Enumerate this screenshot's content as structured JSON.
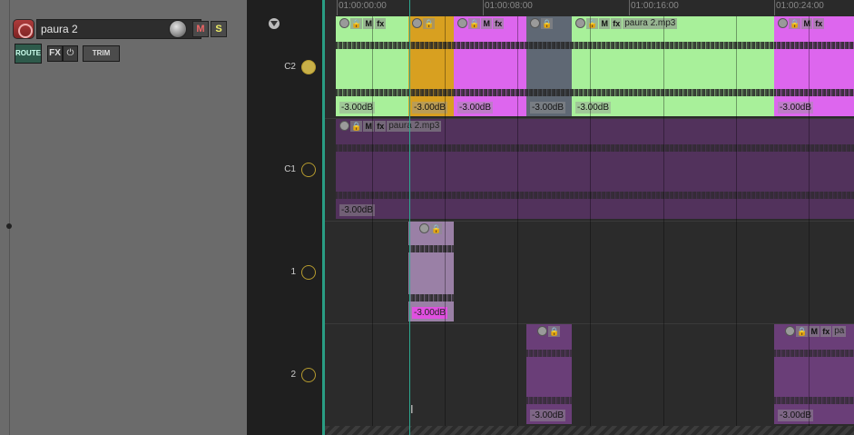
{
  "track": {
    "name": "paura 2",
    "mute_label": "M",
    "solo_label": "S",
    "route_label": "ROUTE",
    "fx_label": "FX",
    "power_label": "⏻",
    "trim_label": "TRIM"
  },
  "children": [
    {
      "label": "C2"
    },
    {
      "label": "C1"
    },
    {
      "label": "1"
    },
    {
      "label": "2"
    }
  ],
  "ruler": {
    "labels": [
      "01:00:00:00",
      "01:00:08:00",
      "01:00:16:00",
      "01:00:24:00"
    ]
  },
  "items": {
    "mute_label": "M",
    "fx_label": "fx",
    "gain_label": "-3.00dB",
    "name_label": "paura 2.mp3",
    "name_truncated": "pa"
  },
  "colors": {
    "green": "#a8f09a",
    "orange": "#d8a020",
    "magenta": "#dd66ee",
    "slate": "#5f6874",
    "purple_dark": "#52325c",
    "purple_light": "#9a80a6",
    "purple_mid": "#6a3e78",
    "accent": "#2a9d83"
  },
  "cursor_glyph": "I"
}
